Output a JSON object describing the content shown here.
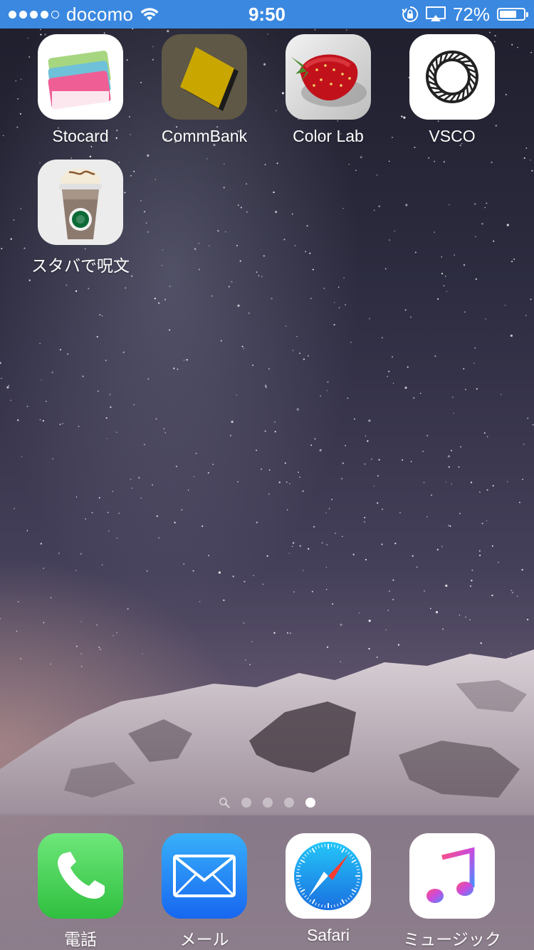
{
  "status_bar": {
    "signal_bars_filled": 4,
    "signal_bars_total": 5,
    "carrier": "docomo",
    "time": "9:50",
    "battery_percent_text": "72%",
    "battery_level": 0.72
  },
  "home_apps": [
    {
      "label": "Stocard",
      "icon": "stocard-icon"
    },
    {
      "label": "CommBank",
      "icon": "commbank-icon"
    },
    {
      "label": "Color Lab",
      "icon": "colorlab-icon"
    },
    {
      "label": "VSCO",
      "icon": "vsco-icon"
    },
    {
      "label": "スタバで呪文",
      "icon": "starbucks-cup-icon"
    }
  ],
  "page_indicator": {
    "pages": 4,
    "current_page": 4,
    "has_search_page": true
  },
  "dock_apps": [
    {
      "label": "電話",
      "icon": "phone-icon"
    },
    {
      "label": "メール",
      "icon": "mail-icon"
    },
    {
      "label": "Safari",
      "icon": "safari-icon"
    },
    {
      "label": "ミュージック",
      "icon": "music-icon"
    }
  ],
  "colors": {
    "status_bar": "#3a88e0",
    "phone_green": "#4cd964",
    "mail_blue": "#1e7ef5",
    "commbank_yellow": "#c9a600"
  }
}
